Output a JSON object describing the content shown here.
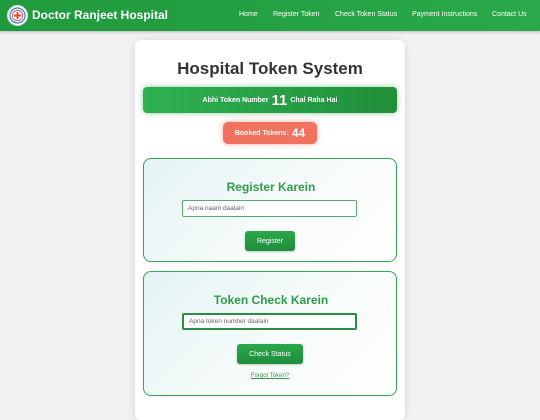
{
  "navbar": {
    "brand": "Doctor Ranjeet Hospital",
    "links": [
      "Home",
      "Register Token",
      "Check Token Status",
      "Payment Instructions",
      "Contact Us"
    ]
  },
  "main": {
    "title": "Hospital Token System",
    "current": {
      "prefix": "Abhi Token Number",
      "number": "11",
      "suffix": "Chal Raha Hai"
    },
    "booked": {
      "label": "Booked Tokens:",
      "count": "44"
    }
  },
  "register": {
    "title": "Register Karein",
    "placeholder": "Apna naam daalain",
    "button": "Register"
  },
  "check": {
    "title": "Token Check Karein",
    "placeholder": "Apna token number daalain",
    "button": "Check Status",
    "forgot": "Forgot Token?"
  },
  "colors": {
    "primary": "#2aa84a",
    "accent": "#f1735f"
  }
}
